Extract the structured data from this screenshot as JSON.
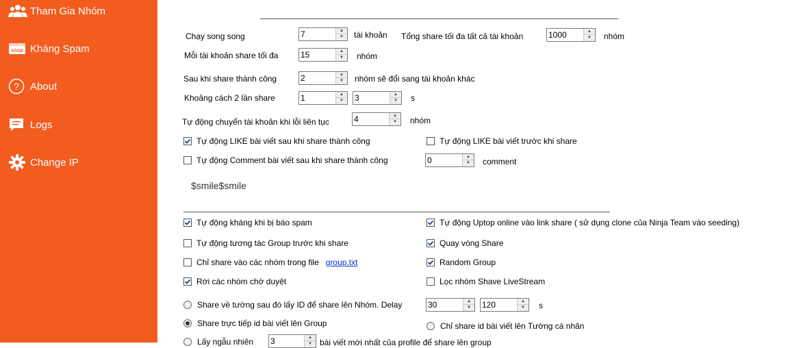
{
  "sidebar": {
    "bg_color": "#f25c1f",
    "items": [
      {
        "label": "Tham Gia Nhóm",
        "icon": "group-icon"
      },
      {
        "label": "Kháng Spam",
        "icon": "spam-icon"
      },
      {
        "label": "About",
        "icon": "question-icon"
      },
      {
        "label": "Logs",
        "icon": "chat-icon"
      },
      {
        "label": "Change IP",
        "icon": "gear-icon"
      }
    ]
  },
  "settings": {
    "parallel_label": "Chạy song song",
    "parallel_value": "7",
    "parallel_unit": "tài khoản",
    "total_share_label": "Tổng share tối đa tất cả tài khoản",
    "total_share_value": "1000",
    "total_share_unit": "nhóm",
    "per_account_label": "Mỗi tài khoản share tối đa",
    "per_account_value": "15",
    "per_account_unit": "nhóm",
    "after_success_label": "Sau khi share thành công",
    "after_success_value": "2",
    "after_success_unit": "nhóm sẽ đổi sang tài khoản khác",
    "interval_label": "Khoảng cách 2 lần share",
    "interval_min": "1",
    "interval_max": "3",
    "interval_unit": "s",
    "auto_switch_label": "Tự động chuyển tài khoản khi lỗi liên tục",
    "auto_switch_value": "4",
    "auto_switch_unit": "nhóm",
    "like_after": {
      "label": "Tự động LIKE bài viết sau khi share thành công",
      "checked": true
    },
    "like_before": {
      "label": "Tự động LIKE bài viết trước khi share",
      "checked": false
    },
    "comment_after": {
      "label": "Tự động Comment bài viết sau khi share thành công",
      "checked": false
    },
    "comment_value": "0",
    "comment_unit": "comment",
    "comment_text": "$smile$smile"
  },
  "options": {
    "anti_spam": {
      "label": "Tự động kháng khi bị báo spam",
      "checked": true
    },
    "uptop_online": {
      "label": "Tự động Uptop online vào link share ( sử dụng clone của Ninja Team vào seeding)",
      "checked": true
    },
    "interact_group": {
      "label": "Tự động tương tác Group trước khi share",
      "checked": false
    },
    "rotate_share": {
      "label": "Quay vòng Share",
      "checked": true
    },
    "only_file_groups": {
      "label": "Chỉ share vào các nhóm trong file",
      "checked": false,
      "link": "group.txt"
    },
    "random_group": {
      "label": "Random Group",
      "checked": true
    },
    "leave_pending": {
      "label": "Rời các nhóm chờ duyệt",
      "checked": true
    },
    "filter_livestream": {
      "label": "Lọc nhóm Shave LiveStream",
      "checked": false
    }
  },
  "share_mode": {
    "wall_then_group": {
      "label": "Share về tường sau đó lấy ID để share lên Nhóm. Delay",
      "selected": false,
      "delay_min": "30",
      "delay_max": "120",
      "unit": "s"
    },
    "direct_group": {
      "label": "Share trực tiếp id bài viết lên Group",
      "selected": true
    },
    "personal_wall": {
      "label": "Chỉ share id bài viết lên Tường cá nhân",
      "selected": false
    },
    "random_profile": {
      "prefix": "Lấy ngẫu nhiên",
      "value": "3",
      "suffix": "bài viết mới nhất của profile để share lên group",
      "selected": false
    }
  }
}
